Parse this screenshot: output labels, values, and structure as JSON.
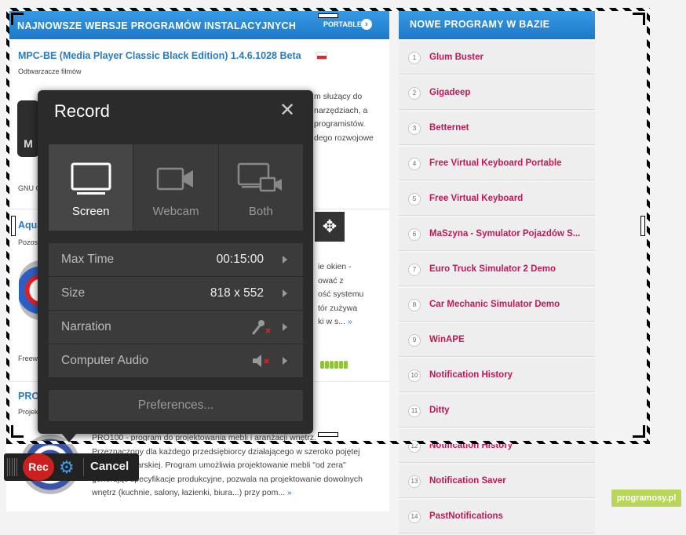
{
  "website": {
    "left_header": {
      "title": "NAJNOWSZE WERSJE PROGRAMÓW INSTALACYJNYCH",
      "portable": "PORTABLE",
      "chevron": "›"
    },
    "entries": [
      {
        "title": "MPC-BE (Media Player Classic Black Edition) 1.4.6.1028 Beta",
        "category": "Odtwarzacze filmów",
        "desc_lines": [
          "m służący do",
          "narzędziach, a",
          "programistów.",
          "dego rozwojowe"
        ],
        "license": "GNU G",
        "thumb_text": "M"
      },
      {
        "title": "Aqua",
        "category": "Pozost",
        "desc_lines": [
          "ie okien -",
          "ować z",
          "ość systemu",
          "tór zużywa",
          "ki w s..."
        ],
        "more": "»",
        "license": "Freew",
        "rating": 5
      },
      {
        "title": "PRO",
        "category": "Projek",
        "desc_lines": [
          "PRO100 - program do projektowania mebli i aranżacji wnętrz.",
          "Przeznaczony dla każdego przedsiębiorcy działającego w szeroko pojętej",
          "branży meblarskiej. Program umożliwia projektowanie mebli \"od zera\"",
          "generując specyfikacje produkcyjne, pozwala na projektowanie dowolnych",
          "wnętrz (kuchnie, salony, łazienki, biura...) przy pom..."
        ],
        "more": "»"
      }
    ],
    "right_header": {
      "title": "NOWE PROGRAMY W BAZIE"
    },
    "new_programs": [
      {
        "n": "1",
        "name": "Glum Buster"
      },
      {
        "n": "2",
        "name": "Gigadeep"
      },
      {
        "n": "3",
        "name": "Betternet"
      },
      {
        "n": "4",
        "name": "Free Virtual Keyboard Portable"
      },
      {
        "n": "5",
        "name": "Free Virtual Keyboard"
      },
      {
        "n": "6",
        "name": "MaSzyna - Symulator Pojazdów S..."
      },
      {
        "n": "7",
        "name": "Euro Truck Simulator 2 Demo"
      },
      {
        "n": "8",
        "name": "Car Mechanic Simulator Demo"
      },
      {
        "n": "9",
        "name": "WinAPE"
      },
      {
        "n": "10",
        "name": "Notification History"
      },
      {
        "n": "11",
        "name": "Ditty"
      },
      {
        "n": "12",
        "name": "Notification History"
      },
      {
        "n": "13",
        "name": "Notification Saver"
      },
      {
        "n": "14",
        "name": "PastNotifications"
      }
    ],
    "logo": "programosy.pl"
  },
  "record_dialog": {
    "title": "Record",
    "close": "✕",
    "modes": [
      {
        "label": "Screen",
        "icon": "monitor-icon",
        "active": true
      },
      {
        "label": "Webcam",
        "icon": "webcam-icon",
        "active": false
      },
      {
        "label": "Both",
        "icon": "screen-and-webcam-icon",
        "active": false
      }
    ],
    "settings": {
      "max_time": {
        "label": "Max Time",
        "value": "00:15:00"
      },
      "size": {
        "label": "Size",
        "value": "818 x 552"
      },
      "narration": {
        "label": "Narration",
        "icon": "microphone-muted-icon"
      },
      "computer_audio": {
        "label": "Computer Audio",
        "icon": "speaker-muted-icon"
      }
    },
    "preferences": "Preferences..."
  },
  "control_bar": {
    "rec": "Rec",
    "gear": "⚙",
    "cancel": "Cancel"
  },
  "move_handle": "✥",
  "colors": {
    "accent_blue": "#1d78c9",
    "link_pink": "#c0185a",
    "rec_red": "#cc1f1f",
    "dialog_bg": "#2b2b2b"
  }
}
